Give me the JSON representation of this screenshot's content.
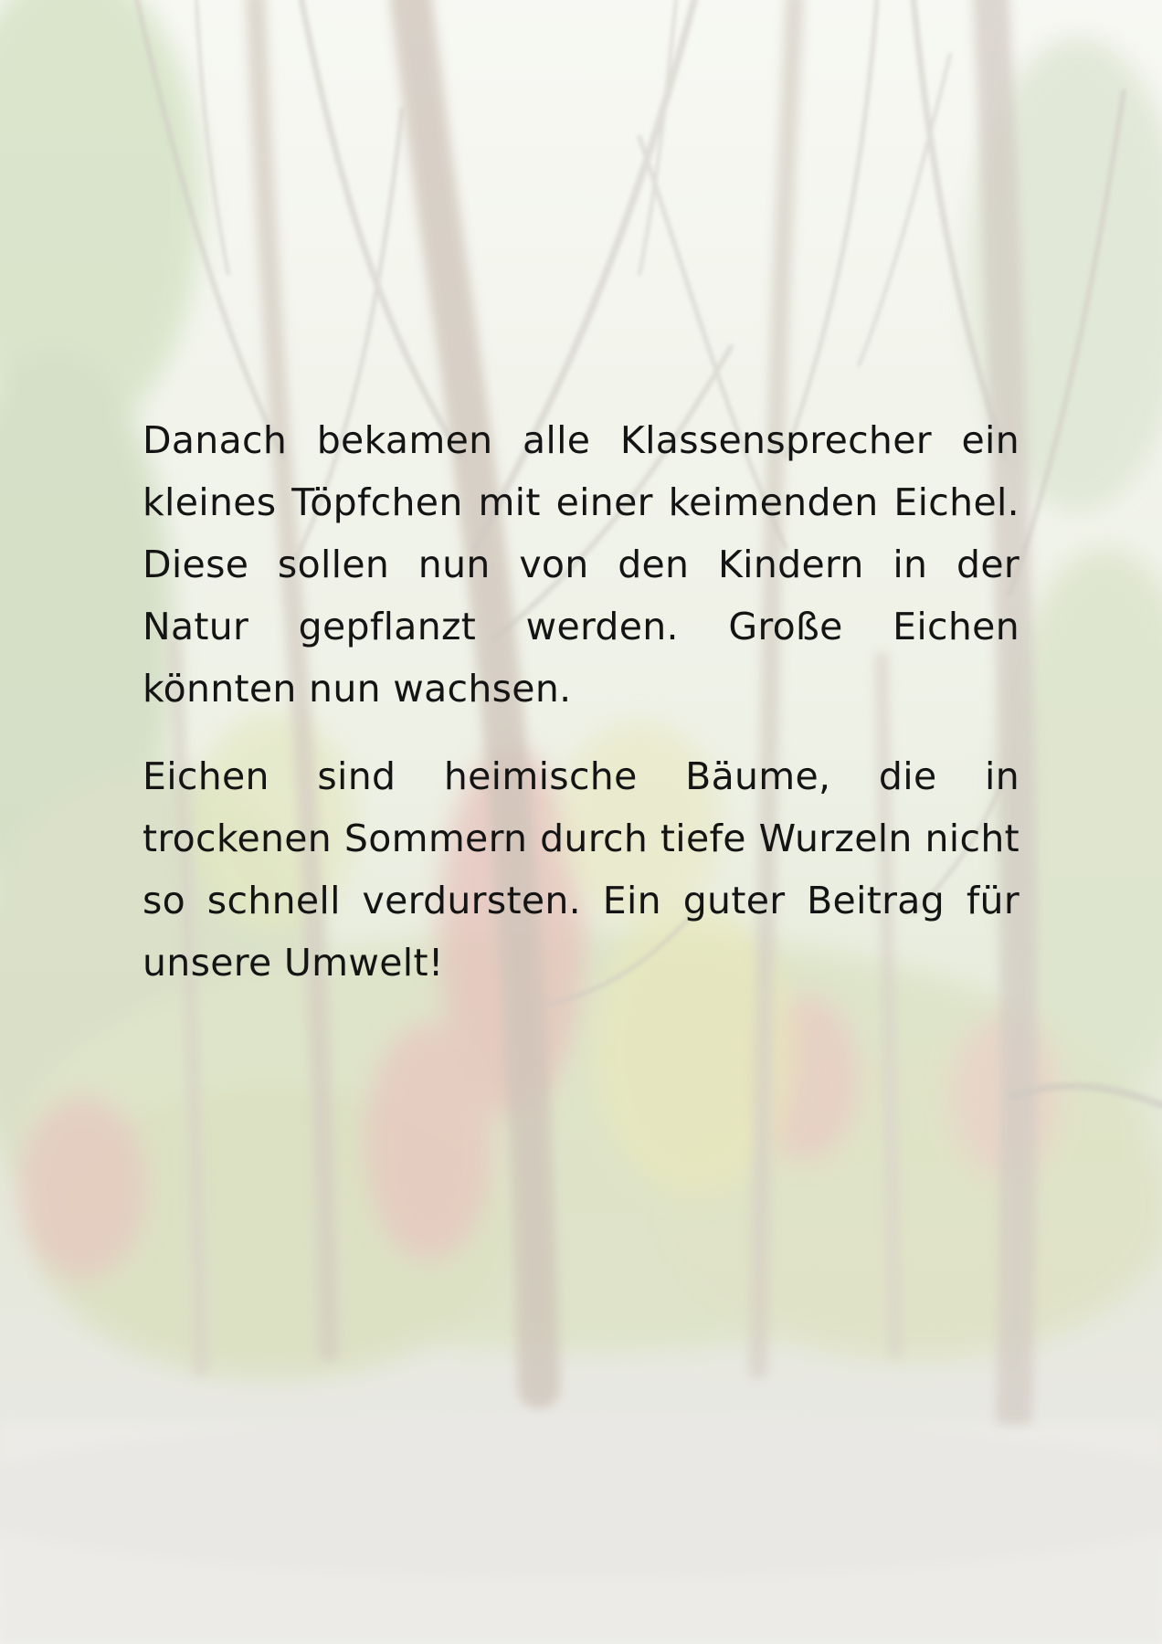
{
  "document": {
    "paragraphs": [
      "Danach bekamen alle Klassensprecher ein kleines Töpfchen mit einer keimenden Eichel. Diese sollen nun von den Kindern in der Natur gepflanzt werden. Große Eichen könnten nun wachsen.",
      "Eichen sind heimische Bäume, die in trockenen Sommern durch tiefe Wurzeln nicht so schnell verdursten. Ein guter Beitrag für unsere Umwelt!"
    ]
  },
  "background": {
    "subject": "faded forest photograph",
    "colors": {
      "sky": "#f6f7f2",
      "foliage": "#cfdcc0",
      "trunk": "#c9c0b6",
      "red_leaves": "#e2b4b0",
      "yellow_leaves": "#e3e3b6",
      "ground": "#ecebe8"
    }
  }
}
